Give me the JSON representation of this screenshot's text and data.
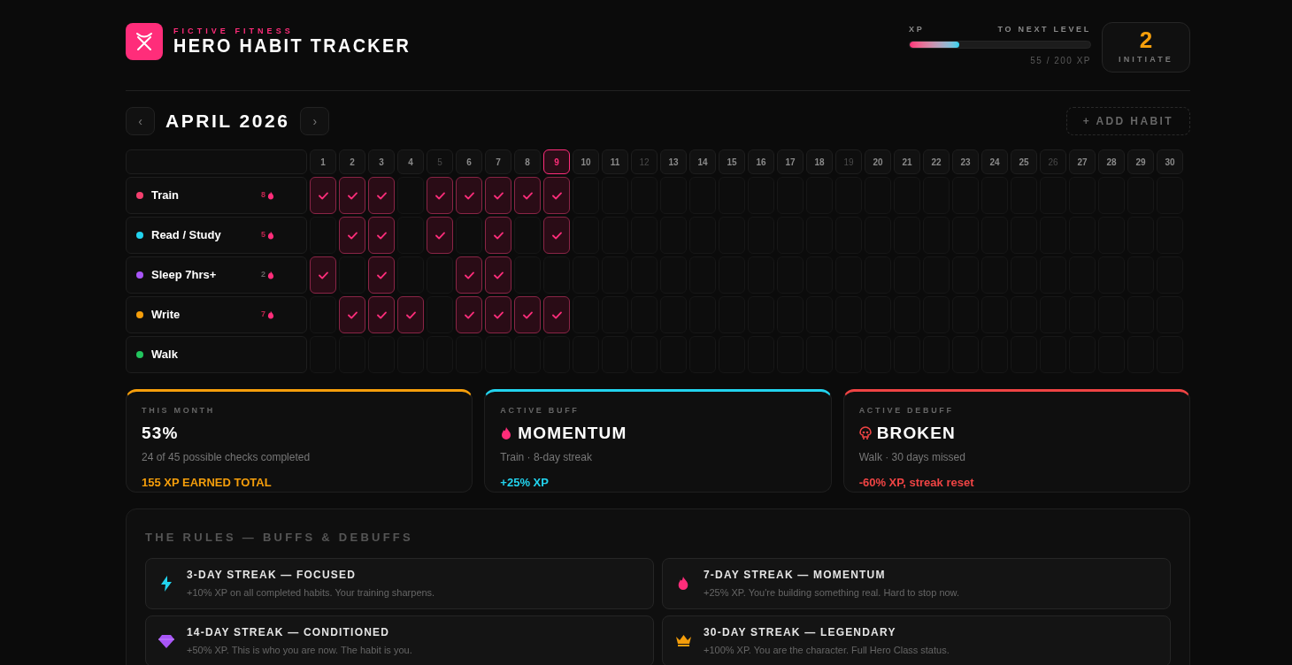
{
  "brand": {
    "tagline": "FICTIVE FITNESS",
    "title": "HERO HABIT TRACKER"
  },
  "xp": {
    "label": "XP",
    "next_label": "TO NEXT LEVEL",
    "level": 0.275,
    "reading": "55 / 200 XP"
  },
  "rank": {
    "level": "2",
    "title": "INITIATE"
  },
  "month": {
    "prev": "‹",
    "title": "APRIL 2026",
    "next": "›"
  },
  "add_habit": "+ ADD HABIT",
  "days": [
    {
      "label": "1",
      "weekend": false,
      "selected": false
    },
    {
      "label": "2",
      "weekend": false,
      "selected": false
    },
    {
      "label": "3",
      "weekend": false,
      "selected": false
    },
    {
      "label": "4",
      "weekend": false,
      "selected": false
    },
    {
      "label": "5",
      "weekend": true,
      "selected": false
    },
    {
      "label": "6",
      "weekend": false,
      "selected": false
    },
    {
      "label": "7",
      "weekend": false,
      "selected": false
    },
    {
      "label": "8",
      "weekend": false,
      "selected": false
    },
    {
      "label": "9",
      "weekend": false,
      "selected": true
    },
    {
      "label": "10",
      "weekend": false,
      "selected": false
    },
    {
      "label": "11",
      "weekend": false,
      "selected": false
    },
    {
      "label": "12",
      "weekend": true,
      "selected": false
    },
    {
      "label": "13",
      "weekend": false,
      "selected": false
    },
    {
      "label": "14",
      "weekend": false,
      "selected": false
    },
    {
      "label": "15",
      "weekend": false,
      "selected": false
    },
    {
      "label": "16",
      "weekend": false,
      "selected": false
    },
    {
      "label": "17",
      "weekend": false,
      "selected": false
    },
    {
      "label": "18",
      "weekend": false,
      "selected": false
    },
    {
      "label": "19",
      "weekend": true,
      "selected": false
    },
    {
      "label": "20",
      "weekend": false,
      "selected": false
    },
    {
      "label": "21",
      "weekend": false,
      "selected": false
    },
    {
      "label": "22",
      "weekend": false,
      "selected": false
    },
    {
      "label": "23",
      "weekend": false,
      "selected": false
    },
    {
      "label": "24",
      "weekend": false,
      "selected": false
    },
    {
      "label": "25",
      "weekend": false,
      "selected": false
    },
    {
      "label": "26",
      "weekend": true,
      "selected": false
    },
    {
      "label": "27",
      "weekend": false,
      "selected": false
    },
    {
      "label": "28",
      "weekend": false,
      "selected": false
    },
    {
      "label": "29",
      "weekend": false,
      "selected": false
    },
    {
      "label": "30",
      "weekend": false,
      "selected": false
    }
  ],
  "habits": [
    {
      "name": "Train",
      "color": "#f43f6e",
      "streak": "8",
      "done": [
        true,
        true,
        true,
        false,
        true,
        true,
        true,
        true,
        true,
        false,
        false,
        false,
        false,
        false,
        false,
        false,
        false,
        false,
        false,
        false,
        false,
        false,
        false,
        false,
        false,
        false,
        false,
        false,
        false,
        false
      ]
    },
    {
      "name": "Read / Study",
      "color": "#22d3ee",
      "streak": "5",
      "done": [
        false,
        true,
        true,
        false,
        true,
        false,
        true,
        false,
        true,
        false,
        false,
        false,
        false,
        false,
        false,
        false,
        false,
        false,
        false,
        false,
        false,
        false,
        false,
        false,
        false,
        false,
        false,
        false,
        false,
        false
      ]
    },
    {
      "name": "Sleep 7hrs+",
      "color": "#a855f7",
      "streak": "2",
      "done": [
        true,
        false,
        true,
        false,
        false,
        true,
        true,
        false,
        false,
        false,
        false,
        false,
        false,
        false,
        false,
        false,
        false,
        false,
        false,
        false,
        false,
        false,
        false,
        false,
        false,
        false,
        false,
        false,
        false,
        false
      ]
    },
    {
      "name": "Write",
      "color": "#f59e0b",
      "streak": "7",
      "done": [
        false,
        true,
        true,
        true,
        false,
        true,
        true,
        true,
        true,
        false,
        false,
        false,
        false,
        false,
        false,
        false,
        false,
        false,
        false,
        false,
        false,
        false,
        false,
        false,
        false,
        false,
        false,
        false,
        false,
        false
      ]
    },
    {
      "name": "Walk",
      "color": "#22c55e",
      "done": [
        false,
        false,
        false,
        false,
        false,
        false,
        false,
        false,
        false,
        false,
        false,
        false,
        false,
        false,
        false,
        false,
        false,
        false,
        false,
        false,
        false,
        false,
        false,
        false,
        false,
        false,
        false,
        false,
        false,
        false
      ]
    }
  ],
  "cards": [
    {
      "kind": "stat",
      "color": "#f59e0b",
      "label": "THIS MONTH",
      "title": "53%",
      "detail": "24 of 45 possible checks completed",
      "effect": "155 XP EARNED TOTAL"
    },
    {
      "kind": "buff",
      "color": "#22d3ee",
      "label": "ACTIVE BUFF",
      "title": "MOMENTUM",
      "detail": "Train · 8-day streak",
      "effect": "+25% XP"
    },
    {
      "kind": "debuff",
      "color": "#ef4444",
      "label": "ACTIVE DEBUFF",
      "title": "BROKEN",
      "detail": "Walk · 30 days missed",
      "effect": "-60% XP, streak reset"
    }
  ],
  "rules": {
    "title": "THE RULES — BUFFS & DEBUFFS",
    "items": [
      {
        "kind": "bolt",
        "title": "3-DAY STREAK — FOCUSED",
        "text": "+10% XP on all completed habits. Your training sharpens."
      },
      {
        "kind": "flame",
        "title": "7-DAY STREAK — MOMENTUM",
        "text": "+25% XP. You're building something real. Hard to stop now."
      },
      {
        "kind": "gem",
        "title": "14-DAY STREAK — CONDITIONED",
        "text": "+50% XP. This is who you are now. The habit is you."
      },
      {
        "kind": "crown",
        "title": "30-DAY STREAK — LEGENDARY",
        "text": "+100% XP. You are the character. Full Hero Class status."
      }
    ]
  }
}
